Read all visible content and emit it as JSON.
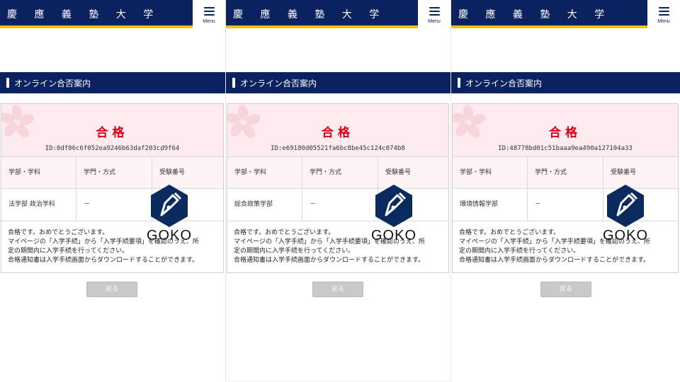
{
  "brand": {
    "name": "慶 應 義 塾 大 学",
    "primary_color": "#0a2260",
    "accent_color": "#f2c200"
  },
  "menu": {
    "label": "Menu",
    "icon": "hamburger-menu-icon"
  },
  "section_title": "オンライン合否案内",
  "result_label": "合格",
  "result_color": "#d9001b",
  "table_headers": [
    "学部・学科",
    "学門・方式",
    "受験番号"
  ],
  "panels": [
    {
      "id_text": "ID:0df86c6f052ea9246b63daf203cd9f64",
      "faculty": "法学部 政治学科",
      "method": "－",
      "exam_number": ""
    },
    {
      "id_text": "ID:e69180d05521fa6bc8be45c124c074b8",
      "faculty": "総合政策学部",
      "method": "－",
      "exam_number": ""
    },
    {
      "id_text": "ID:48778bd01c51baaa9ea490a127104a33",
      "faculty": "環境情報学部",
      "method": "－",
      "exam_number": ""
    }
  ],
  "message_lines": [
    "合格です。おめでとうございます。",
    "マイページの「入学手続」から「入学手続要項」を確認のうえ、所",
    "定の期間内に入学手続を行ってください。",
    "合格通知書は入学手続画面からダウンロードすることができます。"
  ],
  "back_button": "戻る",
  "watermark": {
    "text": "GOKO",
    "icon": "fountain-pen-nib-icon"
  }
}
